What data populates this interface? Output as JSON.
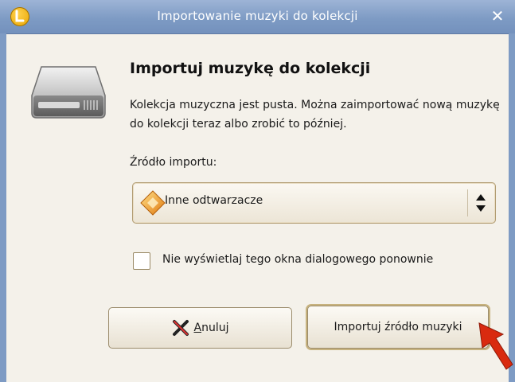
{
  "window": {
    "title": "Importowanie muzyki do kolekcji",
    "close_glyph": "✕"
  },
  "dialog": {
    "heading": "Importuj muzykę do kolekcji",
    "description": "Kolekcja muzyczna jest pusta. Można zaimportować nową muzykę do kolekcji teraz albo zrobić to później.",
    "source_label": "Źródło importu:",
    "source_selected": "Inne odtwarzacze",
    "source_icon": "diamond-player-icon",
    "dont_show_label": "Nie wyświetlaj tego okna dialogowego ponownie",
    "dont_show_checked": false,
    "cancel_button": {
      "mnemonic": "A",
      "rest": "nuluj",
      "icon": "cancel-x-icon"
    },
    "import_button": "Importuj źródło muzyki"
  },
  "colors": {
    "titlebar": "#7e9bc4",
    "pointer": "#d92a0f",
    "background": "#f4f1ea"
  }
}
